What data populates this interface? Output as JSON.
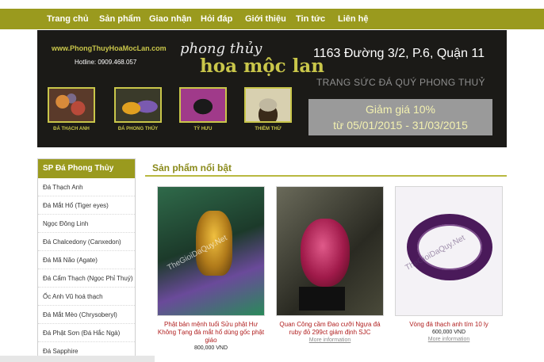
{
  "nav": [
    "Trang chủ",
    "Sản phẩm",
    "Giao nhận",
    "Hỏi đáp",
    "Giới thiệu",
    "Tin tức",
    "Liên hệ"
  ],
  "banner": {
    "url": "www.PhongThuyHoaMocLan.com",
    "hotline": "Hotline: 0909.468.057",
    "logo_top": "phong thủy",
    "logo_bottom": "hoa mộc lan",
    "address": "1163 Đường 3/2, P.6, Quận 11",
    "tagline": "TRANG SỨC ĐÁ QUÝ PHONG THUỶ",
    "promo_line1": "Giảm giá 10%",
    "promo_line2": "từ 05/01/2015 - 31/03/2015",
    "thumbs": [
      "ĐÁ THẠCH ANH",
      "ĐÁ PHONG THỦY",
      "TỲ HƯU",
      "THIỀM THỪ"
    ]
  },
  "sidebar": {
    "title": "SP Đá Phong Thủy",
    "items": [
      "Đá Thạch Anh",
      "Đá Mắt Hổ (Tiger eyes)",
      "Ngọc Đông Linh",
      "Đá Chalcedony (Canxedon)",
      "Đá Mã Não (Agate)",
      "Đá Cẩm Thạch (Ngọc Phỉ Thuý)",
      "Ốc Anh Vũ hoá thạch",
      "Đá Mắt Mèo (Chrysoberyl)",
      "Đá Phật Sơn (Đá Hắc Ngà)",
      "Đá Sapphire"
    ]
  },
  "featured": {
    "title": "Sản phẩm nổi bật",
    "products": [
      {
        "name": "Phật bản mệnh tuổi Sửu phật Hư Không Tạng đá mắt hổ dùng gốc phật giáo",
        "price": "800,000 VND",
        "more": "",
        "watermark": "TheGioiDaQuy.Net"
      },
      {
        "name": "Quan Công cầm Đao cưỡi Ngựa đá ruby đỏ 299ct giám định SJC",
        "price": "",
        "more": "More information",
        "watermark": ""
      },
      {
        "name": "Vòng đá thạch anh tím 10 ly",
        "price": "600,000 VND",
        "more": "More information",
        "watermark": "TheGioiDaQuy.Net"
      }
    ]
  },
  "colors": {
    "accent": "#9a9a1e",
    "banner_bg": "#1b1a17",
    "product_name": "#b01e1e"
  }
}
